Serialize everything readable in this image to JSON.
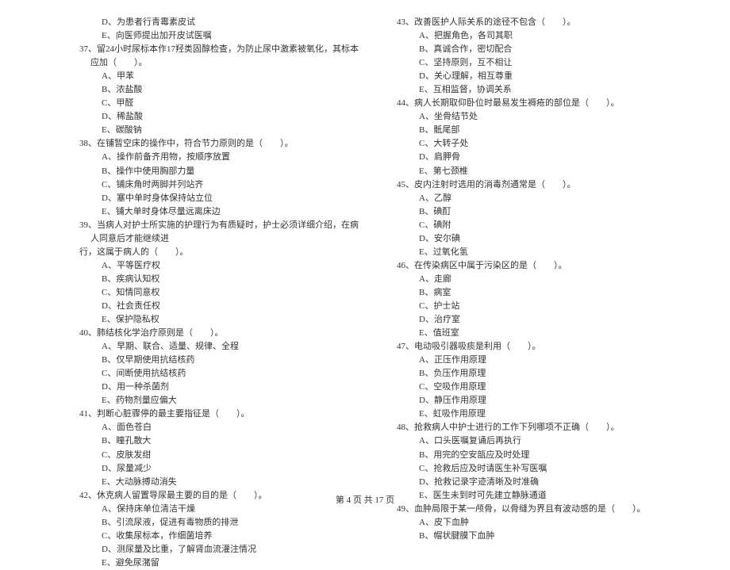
{
  "left_column": [
    {
      "cls": "q-option",
      "text": "D、为患者行青霉素皮试"
    },
    {
      "cls": "q-option",
      "text": "E、向医师提出加开皮试医嘱"
    },
    {
      "cls": "q-stem",
      "text": "37、留24小时尿标本作17羟类固醇检查，为防止尿中激素被氧化，其标本应加（　　）。"
    },
    {
      "cls": "q-option",
      "text": "A、甲苯"
    },
    {
      "cls": "q-option",
      "text": "B、浓盐酸"
    },
    {
      "cls": "q-option",
      "text": "C、甲醛"
    },
    {
      "cls": "q-option",
      "text": "D、稀盐酸"
    },
    {
      "cls": "q-option",
      "text": "E、碳酸钠"
    },
    {
      "cls": "q-stem",
      "text": "38、在铺暂空床的操作中，符合节力原则的是（　　）。"
    },
    {
      "cls": "q-option",
      "text": "A、操作前备齐用物，按顺序放置"
    },
    {
      "cls": "q-option",
      "text": "B、操作中使用胸部力量"
    },
    {
      "cls": "q-option",
      "text": "C、铺床角时两脚并列站齐"
    },
    {
      "cls": "q-option",
      "text": "D、塞中单时身体保持站立位"
    },
    {
      "cls": "q-option",
      "text": "E、铺大单时身体尽量远离床边"
    },
    {
      "cls": "q-stem",
      "text": "39、当病人对护士所实施的护理行为有质疑时，护士必须详细介绍，在病人同意后才能继续进"
    },
    {
      "cls": "q-cont",
      "text": "行，这属于病人的（　　）。"
    },
    {
      "cls": "q-option",
      "text": "A、平等医疗权"
    },
    {
      "cls": "q-option",
      "text": "B、疾病认知权"
    },
    {
      "cls": "q-option",
      "text": "C、知情同意权"
    },
    {
      "cls": "q-option",
      "text": "D、社会责任权"
    },
    {
      "cls": "q-option",
      "text": "E、保护隐私权"
    },
    {
      "cls": "q-stem",
      "text": "40、肺结核化学治疗原则是（　　）。"
    },
    {
      "cls": "q-option",
      "text": "A、早期、联合、适量、规律、全程"
    },
    {
      "cls": "q-option",
      "text": "B、仅早期使用抗结核药"
    },
    {
      "cls": "q-option",
      "text": "C、间断使用抗结核药"
    },
    {
      "cls": "q-option",
      "text": "D、用一种杀菌剂"
    },
    {
      "cls": "q-option",
      "text": "E、药物剂量应偏大"
    },
    {
      "cls": "q-stem",
      "text": "41、判断心脏骤停的最主要指征是（　　）。"
    },
    {
      "cls": "q-option",
      "text": "A、面色苍白"
    },
    {
      "cls": "q-option",
      "text": "B、瞳孔散大"
    },
    {
      "cls": "q-option",
      "text": "C、皮肤发绀"
    },
    {
      "cls": "q-option",
      "text": "D、尿量减少"
    },
    {
      "cls": "q-option",
      "text": "E、大动脉搏动消失"
    },
    {
      "cls": "q-stem",
      "text": "42、休克病人留置导尿最主要的目的是（　　）。"
    },
    {
      "cls": "q-option",
      "text": "A、保持床单位清洁干燥"
    },
    {
      "cls": "q-option",
      "text": "B、引流尿液，促进有毒物质的排泄"
    },
    {
      "cls": "q-option",
      "text": "C、收集尿标本，作细菌培养"
    },
    {
      "cls": "q-option",
      "text": "D、测尿量及比重，了解肾血流灌注情况"
    },
    {
      "cls": "q-option",
      "text": "E、避免尿潴留"
    }
  ],
  "right_column": [
    {
      "cls": "q-stem",
      "text": "43、改善医护人际关系的途径不包含（　　）。"
    },
    {
      "cls": "q-option",
      "text": "A、把握角色，各司其职"
    },
    {
      "cls": "q-option",
      "text": "B、真诚合作，密切配合"
    },
    {
      "cls": "q-option",
      "text": "C、坚持原则，互不相让"
    },
    {
      "cls": "q-option",
      "text": "D、关心理解，相互尊重"
    },
    {
      "cls": "q-option",
      "text": "E、互相监督，协调关系"
    },
    {
      "cls": "q-stem",
      "text": "44、病人长期取仰卧位时最易发生褥疮的部位是（　　）。"
    },
    {
      "cls": "q-option",
      "text": "A、坐骨结节处"
    },
    {
      "cls": "q-option",
      "text": "B、骶尾部"
    },
    {
      "cls": "q-option",
      "text": "C、大转子处"
    },
    {
      "cls": "q-option",
      "text": "D、肩胛骨"
    },
    {
      "cls": "q-option",
      "text": "E、第七颈椎"
    },
    {
      "cls": "q-stem",
      "text": "45、皮内注射时选用的消毒剂通常是（　　）。"
    },
    {
      "cls": "q-option",
      "text": "A、乙醇"
    },
    {
      "cls": "q-option",
      "text": "B、碘酊"
    },
    {
      "cls": "q-option",
      "text": "C、碘附"
    },
    {
      "cls": "q-option",
      "text": "D、安尔碘"
    },
    {
      "cls": "q-option",
      "text": "E、过氧化氢"
    },
    {
      "cls": "q-stem",
      "text": "46、在传染病区中属于污染区的是（　　）。"
    },
    {
      "cls": "q-option",
      "text": "A、走廊"
    },
    {
      "cls": "q-option",
      "text": "B、病室"
    },
    {
      "cls": "q-option",
      "text": "C、护士站"
    },
    {
      "cls": "q-option",
      "text": "D、治疗室"
    },
    {
      "cls": "q-option",
      "text": "E、值班室"
    },
    {
      "cls": "q-stem",
      "text": "47、电动吸引器吸痰是利用（　　）。"
    },
    {
      "cls": "q-option",
      "text": "A、正压作用原理"
    },
    {
      "cls": "q-option",
      "text": "B、负压作用原理"
    },
    {
      "cls": "q-option",
      "text": "C、空吸作用原理"
    },
    {
      "cls": "q-option",
      "text": "D、静压作用原理"
    },
    {
      "cls": "q-option",
      "text": "E、虹吸作用原理"
    },
    {
      "cls": "q-stem",
      "text": "48、抢救病人中护士进行的工作下列哪项不正确（　　）。"
    },
    {
      "cls": "q-option",
      "text": "A、口头医嘱复诵后再执行"
    },
    {
      "cls": "q-option",
      "text": "B、用完的空安瓿应及时处理"
    },
    {
      "cls": "q-option",
      "text": "C、抢救后应及时请医生补写医嘱"
    },
    {
      "cls": "q-option",
      "text": "D、抢救记录字迹清晰及时准确"
    },
    {
      "cls": "q-option",
      "text": "E、医生未到时可先建立静脉通道"
    },
    {
      "cls": "q-stem",
      "text": "49、血肿局限于某一颅骨，以骨缝为界且有波动感的是（　　）。"
    },
    {
      "cls": "q-option",
      "text": "A、皮下血肿"
    },
    {
      "cls": "q-option",
      "text": "B、帽状腱膜下血肿"
    }
  ],
  "footer": "第 4 页  共 17 页"
}
